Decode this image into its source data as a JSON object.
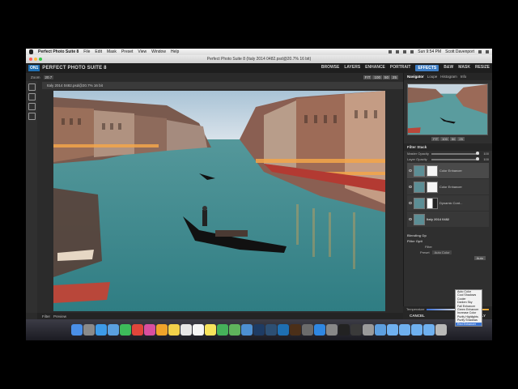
{
  "menubar": {
    "app_name": "Perfect Photo Suite 8",
    "items": [
      "File",
      "Edit",
      "Mask",
      "Preset",
      "View",
      "Window",
      "Help"
    ],
    "clock": "Sun 9:54 PM",
    "user": "Scott Davenport"
  },
  "window": {
    "title": "Perfect Photo Suite 8 (Italy 2014 0482.psd@20.7% 16 bit)"
  },
  "app": {
    "logo": "ON1",
    "brand": "PERFECT PHOTO SUITE 8",
    "modules": [
      {
        "label": "BROWSE",
        "active": false
      },
      {
        "label": "LAYERS",
        "active": false
      },
      {
        "label": "ENHANCE",
        "active": false
      },
      {
        "label": "PORTRAIT",
        "active": false
      },
      {
        "label": "EFFECTS",
        "active": true
      },
      {
        "label": "B&W",
        "active": false
      },
      {
        "label": "MASK",
        "active": false
      },
      {
        "label": "RESIZE",
        "active": false
      }
    ]
  },
  "toolbar": {
    "zoom_label": "Zoom",
    "zoom_value": "20.7",
    "zoom_buttons": [
      "FIT",
      "100",
      "50",
      "25"
    ]
  },
  "document": {
    "tab_label": "Italy 2014 0482.psd@20.7% 16 bit"
  },
  "bottom": {
    "filter_label": "Filter",
    "preview_label": "Preview"
  },
  "navigator": {
    "tabs": [
      {
        "label": "Navigator",
        "active": true
      },
      {
        "label": "Loupe",
        "active": false
      },
      {
        "label": "Histogram",
        "active": false
      },
      {
        "label": "Info",
        "active": false
      }
    ],
    "zoom_buttons": [
      "FIT",
      "100",
      "50",
      "25"
    ]
  },
  "filter_stack": {
    "title": "Filter Stack",
    "master_opacity_label": "Master Opacity",
    "master_opacity": "100",
    "master_opacity_level": 1.0,
    "layer_opacity_label": "Layer Opacity",
    "layer_opacity": "100",
    "layer_opacity_level": 1.0,
    "layers": [
      {
        "name": "Color Enhancer",
        "selected": true,
        "mask": "full"
      },
      {
        "name": "Color Enhancer",
        "selected": false,
        "mask": "full"
      },
      {
        "name": "Dynamic Cont...",
        "selected": false,
        "mask": "half"
      },
      {
        "name": "Italy 2014 0482",
        "selected": false,
        "mask": "none"
      }
    ],
    "blending_label": "Blending Op",
    "filter_options_label": "Filter Opti",
    "filter_label": "Filter",
    "preset_label": "Preset",
    "preset_value": "Auto Color",
    "auto_button": "Auto"
  },
  "preset_dropdown": {
    "options": [
      "Auto Color",
      "Cool Shadows",
      "Cooler",
      "Darken Sky",
      "Fall Enhancer",
      "Green Enhancer",
      "Increase Color",
      "Purify Highlights",
      "Purify Shadows",
      "Red Enhancer"
    ],
    "highlighted": "Red Enhancer"
  },
  "temperature": {
    "label": "Temperature",
    "level": 0.55
  },
  "actions": {
    "cancel": "CANCEL",
    "apply": "APPLY"
  },
  "dock": {
    "icons": [
      "finder-icon",
      "launchpad-icon",
      "safari-icon",
      "mail-icon",
      "facetime-icon",
      "chrome-icon",
      "itunes-icon",
      "photos-icon",
      "notes-icon",
      "calendar-icon",
      "reminders-icon",
      "stickies-icon",
      "messages-icon",
      "maps-icon",
      "iphoto-icon",
      "photoshop-icon",
      "lightroom-icon",
      "on1-icon",
      "bridge-icon",
      "aperture-icon",
      "app-store-icon",
      "preferences-icon",
      "terminal-icon",
      "activity-icon",
      "screenshot-icon",
      "downloads-icon",
      "folder-icon",
      "folder-icon",
      "folder-icon",
      "documents-icon",
      "trash-icon"
    ]
  }
}
